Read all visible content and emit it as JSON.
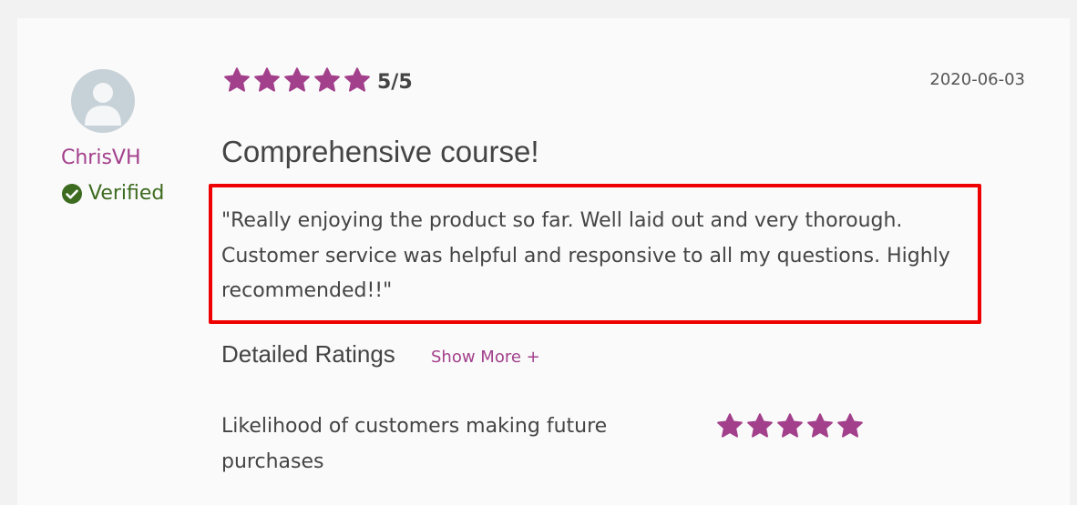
{
  "colors": {
    "accent": "#a3408c",
    "verified": "#3d6b1f",
    "highlight_border": "#ee0000",
    "avatar_bg": "#c7d2d8"
  },
  "reviewer": {
    "name": "ChrisVH",
    "verified_label": "Verified",
    "avatar_icon": "user-silhouette-icon"
  },
  "review": {
    "rating_stars": 5,
    "max_stars": 5,
    "score_text": "5/5",
    "date": "2020-06-03",
    "title": "Comprehensive course!",
    "body": "\"Really enjoying the product so far. Well laid out and very thorough. Customer service was helpful and responsive to all my questions. Highly recommended!!\""
  },
  "detailed_ratings": {
    "heading": "Detailed Ratings",
    "show_more_label": "Show More +",
    "items": [
      {
        "label": "Likelihood of customers making future purchases",
        "stars": 5
      }
    ]
  }
}
